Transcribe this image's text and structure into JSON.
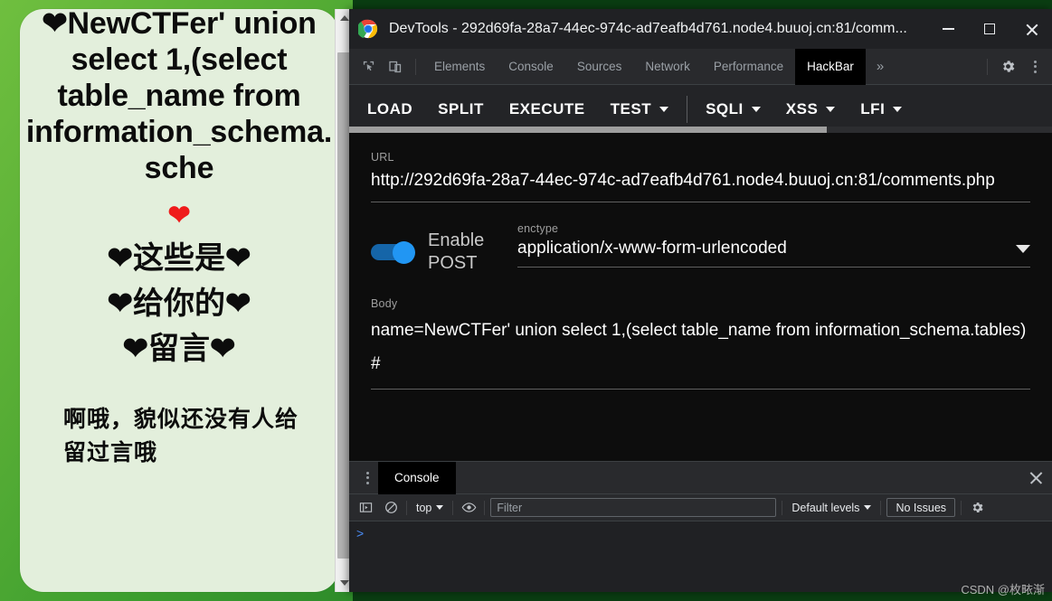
{
  "page": {
    "sql_message": "❤NewCTFer' union select 1,(select table_name from information_schema.sche",
    "solo_heart": "❤",
    "cn_line1": "❤这些是❤",
    "cn_line2": "❤给你的❤",
    "cn_line3": "❤留言❤",
    "tail_text": "啊哦，貌似还没有人给 留过言哦"
  },
  "window": {
    "title": "DevTools - 292d69fa-28a7-44ec-974c-ad7eafb4d761.node4.buuoj.cn:81/comm...",
    "minimize_label": "minimize",
    "maximize_label": "maximize",
    "close_label": "close"
  },
  "devtools": {
    "inspect_icon": "inspect-element-icon",
    "device_icon": "device-toolbar-icon",
    "tabs": [
      {
        "label": "Elements",
        "active": false
      },
      {
        "label": "Console",
        "active": false
      },
      {
        "label": "Sources",
        "active": false
      },
      {
        "label": "Network",
        "active": false
      },
      {
        "label": "Performance",
        "active": false
      },
      {
        "label": "HackBar",
        "active": true
      }
    ],
    "more_tabs": "»",
    "settings_icon": "gear-icon",
    "kebab_icon": "more-options-icon"
  },
  "hackbar": {
    "menus": [
      {
        "label": "LOAD",
        "has_caret": false
      },
      {
        "label": "SPLIT",
        "has_caret": false
      },
      {
        "label": "EXECUTE",
        "has_caret": false
      },
      {
        "label": "TEST",
        "has_caret": true
      },
      {
        "label": "SQLI",
        "has_caret": true
      },
      {
        "label": "XSS",
        "has_caret": true
      },
      {
        "label": "LFI",
        "has_caret": true
      }
    ],
    "url_label": "URL",
    "url_value": "http://292d69fa-28a7-44ec-974c-ad7eafb4d761.node4.buuoj.cn:81/comments.php",
    "post_toggle_label": "Enable POST",
    "post_toggle_on": true,
    "enctype_label": "enctype",
    "enctype_value": "application/x-www-form-urlencoded",
    "body_label": "Body",
    "body_value": "name=NewCTFer' union select 1,(select table_name from information_schema.tables)#"
  },
  "console": {
    "tab_label": "Console",
    "close_icon": "close-icon",
    "sidebar_icon": "console-sidebar-icon",
    "clear_icon": "clear-console-icon",
    "context_value": "top",
    "eye_icon": "live-expression-icon",
    "filter_placeholder": "Filter",
    "levels_value": "Default levels",
    "issues_label": "No Issues",
    "settings_icon": "gear-icon",
    "prompt": ">"
  },
  "watermark": "CSDN @枚畩渐",
  "colors": {
    "accent_blue": "#2196f3",
    "page_green": "#57ad35",
    "card_bg": "#e3efdc",
    "heart_red": "#ef1b1b",
    "devtools_bg": "#202124",
    "hackbar_panel": "#0d0d0d"
  }
}
